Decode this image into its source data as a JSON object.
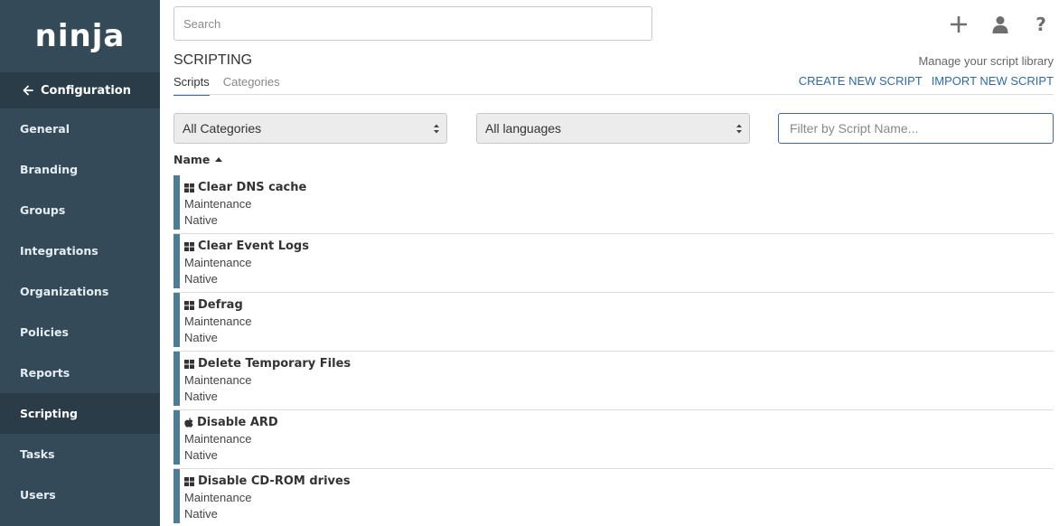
{
  "brand": {
    "logo_text": "ninja"
  },
  "sidebar": {
    "header": "Configuration",
    "items": [
      {
        "label": "General",
        "active": false
      },
      {
        "label": "Branding",
        "active": false
      },
      {
        "label": "Groups",
        "active": false
      },
      {
        "label": "Integrations",
        "active": false
      },
      {
        "label": "Organizations",
        "active": false
      },
      {
        "label": "Policies",
        "active": false
      },
      {
        "label": "Reports",
        "active": false
      },
      {
        "label": "Scripting",
        "active": true
      },
      {
        "label": "Tasks",
        "active": false
      },
      {
        "label": "Users",
        "active": false
      }
    ]
  },
  "topbar": {
    "search_placeholder": "Search",
    "icons": [
      "plus-icon",
      "user-icon",
      "help-icon"
    ]
  },
  "page": {
    "title": "SCRIPTING",
    "subtitle": "Manage your script library",
    "tabs": [
      {
        "label": "Scripts",
        "active": true
      },
      {
        "label": "Categories",
        "active": false
      }
    ],
    "actions": {
      "create": "CREATE NEW SCRIPT",
      "import": "IMPORT NEW SCRIPT"
    }
  },
  "filters": {
    "category_selected": "All Categories",
    "language_selected": "All languages",
    "name_placeholder": "Filter by Script Name..."
  },
  "table": {
    "column": "Name",
    "sort": "ascending",
    "rows": [
      {
        "name": "Clear DNS cache",
        "category": "Maintenance",
        "language": "Native",
        "os": "windows"
      },
      {
        "name": "Clear Event Logs",
        "category": "Maintenance",
        "language": "Native",
        "os": "windows"
      },
      {
        "name": "Defrag",
        "category": "Maintenance",
        "language": "Native",
        "os": "windows"
      },
      {
        "name": "Delete Temporary Files",
        "category": "Maintenance",
        "language": "Native",
        "os": "windows"
      },
      {
        "name": "Disable ARD",
        "category": "Maintenance",
        "language": "Native",
        "os": "apple"
      },
      {
        "name": "Disable CD-ROM drives",
        "category": "Maintenance",
        "language": "Native",
        "os": "windows"
      }
    ]
  },
  "colors": {
    "sidebar_bg": "#344a58",
    "sidebar_active_bg": "#2a3c48",
    "accent_link": "#3169a6",
    "row_bar": "#4e7c92"
  }
}
